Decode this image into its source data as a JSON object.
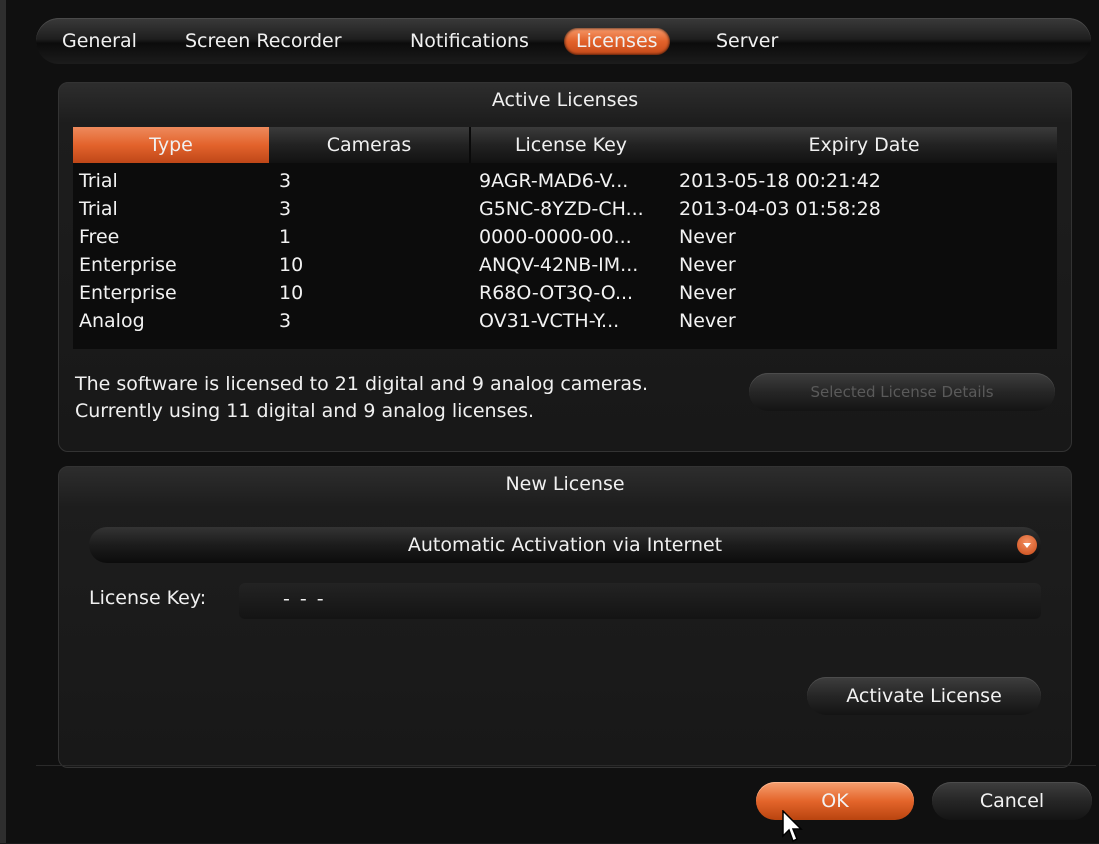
{
  "tabs": [
    {
      "label": "General",
      "active": false
    },
    {
      "label": "Screen Recorder",
      "active": false
    },
    {
      "label": "Notifications",
      "active": false
    },
    {
      "label": "Licenses",
      "active": true
    },
    {
      "label": "Server",
      "active": false
    }
  ],
  "active_licenses": {
    "title": "Active Licenses",
    "columns": [
      "Type",
      "Cameras",
      "License Key",
      "Expiry Date"
    ],
    "sorted_column": "Type",
    "rows": [
      {
        "type": "Trial",
        "cameras": "3",
        "key": "9AGR-MAD6-V...",
        "expiry": "2013-05-18 00:21:42"
      },
      {
        "type": "Trial",
        "cameras": "3",
        "key": "G5NC-8YZD-CH...",
        "expiry": "2013-04-03 01:58:28"
      },
      {
        "type": "Free",
        "cameras": "1",
        "key": "0000-0000-00...",
        "expiry": "Never"
      },
      {
        "type": "Enterprise",
        "cameras": "10",
        "key": "ANQV-42NB-IM...",
        "expiry": "Never"
      },
      {
        "type": "Enterprise",
        "cameras": "10",
        "key": "R68O-OT3Q-O...",
        "expiry": "Never"
      },
      {
        "type": "Analog",
        "cameras": "3",
        "key": "OV31-VCTH-Y...",
        "expiry": "Never"
      }
    ],
    "info_line1": "The software is licensed to 21 digital and 9 analog cameras.",
    "info_line2": "Currently using 11 digital and 9 analog licenses.",
    "details_button": "Selected License Details"
  },
  "new_license": {
    "title": "New License",
    "method": "Automatic Activation via Internet",
    "key_label": "License Key:",
    "key_value": "- - -",
    "activate_button": "Activate License"
  },
  "footer": {
    "ok_label": "OK",
    "cancel_label": "Cancel"
  },
  "colors": {
    "accent": "#e4652b",
    "background": "#101010"
  }
}
